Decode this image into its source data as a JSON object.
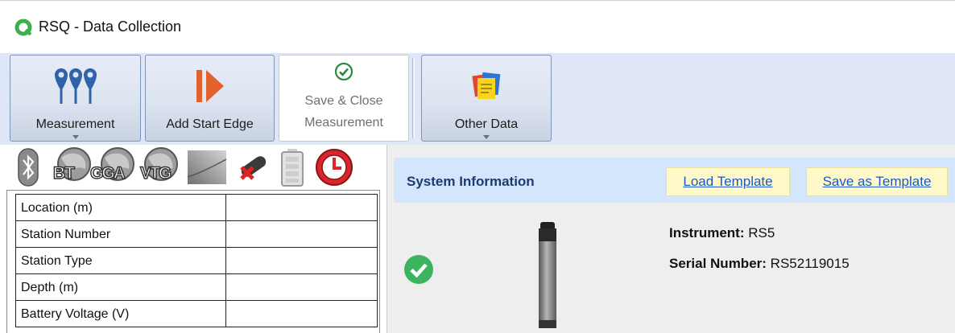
{
  "window": {
    "title": "RSQ - Data Collection",
    "icon": "app-q-logo-icon"
  },
  "ribbon": {
    "buttons": [
      {
        "label": "Measurement",
        "icon": "map-pins-icon",
        "has_dropdown": true
      },
      {
        "label": "Add Start Edge",
        "icon": "start-edge-icon",
        "has_dropdown": false
      },
      {
        "label_line1": "Save & Close",
        "label_line2": "Measurement",
        "icon": "check-circle-icon",
        "enabled": false
      },
      {
        "label": "Other Data",
        "icon": "notes-icon",
        "has_dropdown": true
      }
    ]
  },
  "status_bar": {
    "icons": [
      "bluetooth-icon",
      "globe-bt-icon",
      "globe-gga-icon",
      "globe-vtg-icon",
      "signal-gradient-icon",
      "probe-disconnected-icon",
      "battery-icon",
      "clock-alarm-icon"
    ],
    "globe_labels": [
      "BT",
      "GGA",
      "VTG"
    ]
  },
  "grid": {
    "rows": [
      {
        "label": "Location (m)",
        "value": ""
      },
      {
        "label": "Station Number",
        "value": ""
      },
      {
        "label": "Station Type",
        "value": ""
      },
      {
        "label": "Depth (m)",
        "value": ""
      },
      {
        "label": "Battery Voltage (V)",
        "value": ""
      }
    ]
  },
  "system_info": {
    "title": "System Information",
    "load_template": "Load Template",
    "save_template": "Save as Template",
    "instrument_label": "Instrument:",
    "instrument_value": "RS5",
    "serial_label": "Serial Number:",
    "serial_value": "RS52119015",
    "status_icon": "check-circle-icon"
  },
  "colors": {
    "ribbon_bg": "#dfe6f8",
    "header_bg": "#d4e6fb",
    "link": "#1a5ac8",
    "ok_green": "#3cb35f",
    "alarm_red": "#d9262c"
  }
}
